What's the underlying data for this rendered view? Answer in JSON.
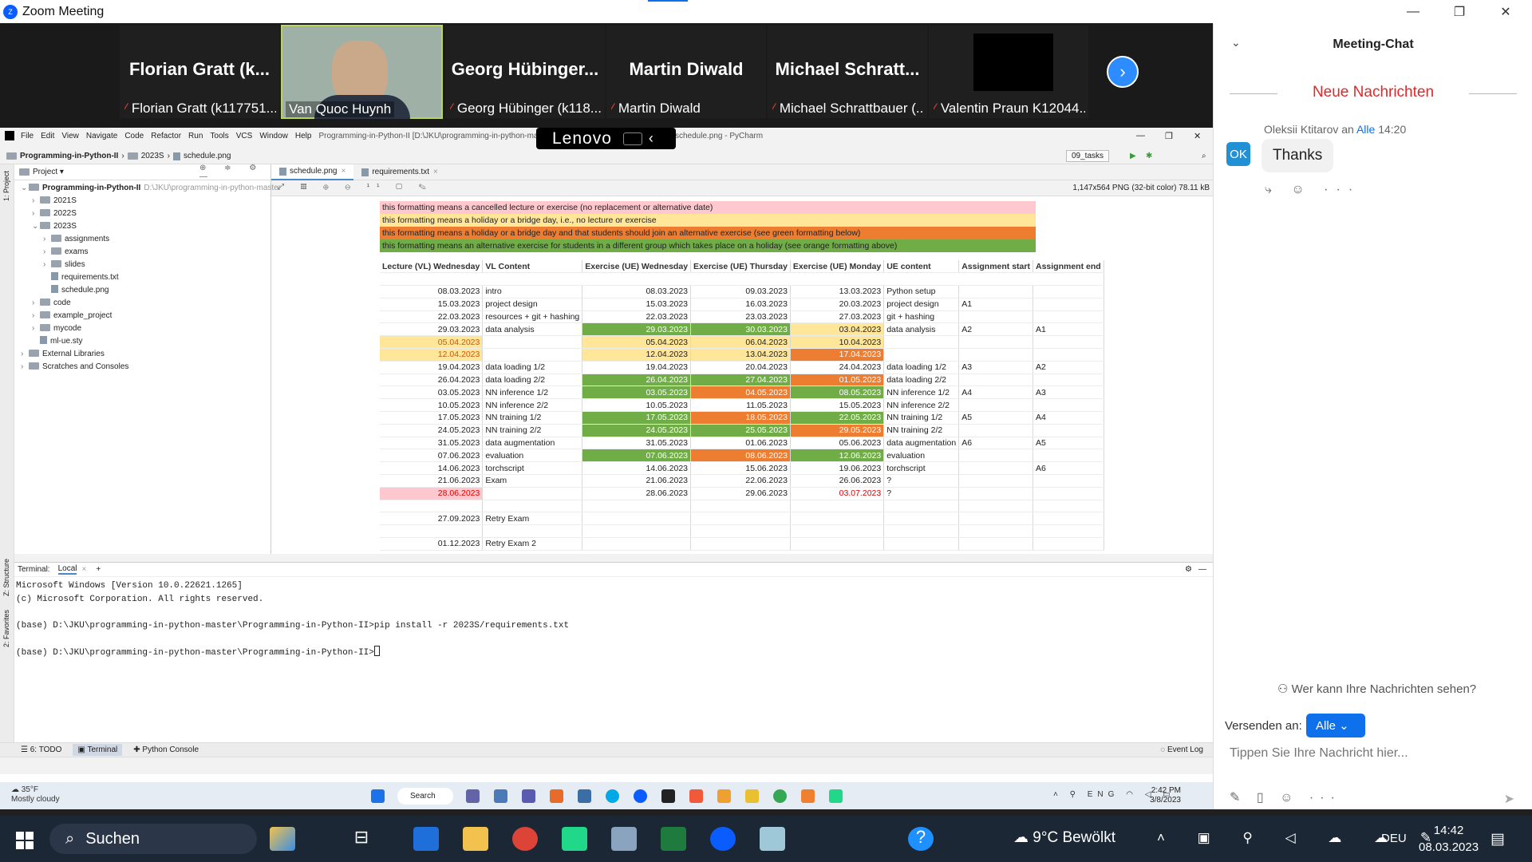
{
  "zoom": {
    "title": "Zoom Meeting",
    "logo": "Z",
    "min": "—",
    "restore": "❐",
    "close": "✕"
  },
  "participants": [
    {
      "big": "Florian Gratt (k...",
      "small": "Florian Gratt (k117751..."
    },
    {
      "big": "",
      "small": "Van Quoc Huynh"
    },
    {
      "big": "Georg Hübinger...",
      "small": "Georg Hübinger (k118..."
    },
    {
      "big": "Martin Diwald",
      "small": "Martin Diwald"
    },
    {
      "big": "Michael  Schratt...",
      "small": "Michael Schrattbauer (..."
    },
    {
      "big": "",
      "small": "Valentin Praun K12044..."
    }
  ],
  "next_icon": "›",
  "chat": {
    "header": "Meeting-Chat",
    "chev": "⌄",
    "new_messages": "Neue Nachrichten",
    "msg": {
      "sender": "Oleksii Ktitarov",
      "to_word": "an",
      "to": "Alle",
      "time": "14:20",
      "avatar": "OK",
      "text": "Thanks"
    },
    "actions": "⤷ ☺ ···",
    "who": "Wer kann Ihre Nachrichten sehen?",
    "send_label": "Versenden an:",
    "send_to": "Alle ⌄",
    "placeholder": "Tippen Sie Ihre Nachricht hier...",
    "tools": "✎ ▯ ☺ ···",
    "send_icon": "➤"
  },
  "pycharm": {
    "menu": [
      "File",
      "Edit",
      "View",
      "Navigate",
      "Code",
      "Refactor",
      "Run",
      "Tools",
      "VCS",
      "Window",
      "Help"
    ],
    "title": "Programming-in-Python-II [D:\\JKU\\programming-in-python-mast",
    "title2": "schedule.png - PyCharm",
    "lenovo": "Lenovo",
    "breadcrumb": [
      "Programming-in-Python-II",
      "2023S",
      "schedule.png"
    ],
    "run_config": "09_tasks",
    "project_label": "Project ▾",
    "tree": [
      {
        "label": "Programming-in-Python-II",
        "extra": "D:\\JKU\\programming-in-python-master",
        "depth": 0,
        "kind": "folder"
      },
      {
        "label": "2021S",
        "depth": 1,
        "kind": "folder"
      },
      {
        "label": "2022S",
        "depth": 1,
        "kind": "folder"
      },
      {
        "label": "2023S",
        "depth": 1,
        "kind": "folder"
      },
      {
        "label": "assignments",
        "depth": 2,
        "kind": "folder"
      },
      {
        "label": "exams",
        "depth": 2,
        "kind": "folder"
      },
      {
        "label": "slides",
        "depth": 2,
        "kind": "folder"
      },
      {
        "label": "requirements.txt",
        "depth": 2,
        "kind": "file"
      },
      {
        "label": "schedule.png",
        "depth": 2,
        "kind": "file"
      },
      {
        "label": "code",
        "depth": 1,
        "kind": "folder"
      },
      {
        "label": "example_project",
        "depth": 1,
        "kind": "folder"
      },
      {
        "label": "mycode",
        "depth": 1,
        "kind": "folder"
      },
      {
        "label": "ml-ue.sty",
        "depth": 1,
        "kind": "file"
      },
      {
        "label": "External Libraries",
        "depth": 0,
        "kind": "folder"
      },
      {
        "label": "Scratches and Consoles",
        "depth": 0,
        "kind": "folder"
      }
    ],
    "tabs": [
      "schedule.png",
      "requirements.txt"
    ],
    "image_info": "1,147x564 PNG (32-bit color) 78.11 kB",
    "legend": [
      "this formatting means a cancelled lecture or exercise (no replacement or alternative date)",
      "this formatting means a holiday or a bridge day, i.e., no lecture or exercise",
      "this formatting means a holiday or a bridge day and that students should join an alternative exercise (see green formatting below)",
      "this formatting means an alternative exercise for students in a different group which takes place on a holiday (see orange formatting above)"
    ],
    "headers": [
      "Lecture (VL) Wednesday",
      "VL Content",
      "Exercise (UE) Wednesday",
      "Exercise (UE) Thursday",
      "Exercise (UE) Monday",
      "UE content",
      "Assignment start",
      "Assignment end"
    ],
    "rows": [
      [
        "08.03.2023",
        "intro",
        "08.03.2023",
        "09.03.2023",
        "13.03.2023",
        "Python setup",
        "",
        ""
      ],
      [
        "15.03.2023",
        "project design",
        "15.03.2023",
        "16.03.2023",
        "20.03.2023",
        "project design",
        "A1",
        ""
      ],
      [
        "22.03.2023",
        "resources + git + hashing",
        "22.03.2023",
        "23.03.2023",
        "27.03.2023",
        "git + hashing",
        "",
        ""
      ],
      [
        "29.03.2023",
        "data analysis",
        "29.03.2023",
        "30.03.2023",
        "03.04.2023",
        "data analysis",
        "A2",
        "A1"
      ],
      [
        "05.04.2023",
        "",
        "05.04.2023",
        "06.04.2023",
        "10.04.2023",
        "",
        "",
        ""
      ],
      [
        "12.04.2023",
        "",
        "12.04.2023",
        "13.04.2023",
        "17.04.2023",
        "",
        "",
        ""
      ],
      [
        "19.04.2023",
        "data loading 1/2",
        "19.04.2023",
        "20.04.2023",
        "24.04.2023",
        "data loading 1/2",
        "A3",
        "A2"
      ],
      [
        "26.04.2023",
        "data loading 2/2",
        "26.04.2023",
        "27.04.2023",
        "01.05.2023",
        "data loading 2/2",
        "",
        ""
      ],
      [
        "03.05.2023",
        "NN inference 1/2",
        "03.05.2023",
        "04.05.2023",
        "08.05.2023",
        "NN inference 1/2",
        "A4",
        "A3"
      ],
      [
        "10.05.2023",
        "NN inference 2/2",
        "10.05.2023",
        "11.05.2023",
        "15.05.2023",
        "NN inference 2/2",
        "",
        ""
      ],
      [
        "17.05.2023",
        "NN training 1/2",
        "17.05.2023",
        "18.05.2023",
        "22.05.2023",
        "NN training 1/2",
        "A5",
        "A4"
      ],
      [
        "24.05.2023",
        "NN training 2/2",
        "24.05.2023",
        "25.05.2023",
        "29.05.2023",
        "NN training 2/2",
        "",
        ""
      ],
      [
        "31.05.2023",
        "data augmentation",
        "31.05.2023",
        "01.06.2023",
        "05.06.2023",
        "data augmentation",
        "A6",
        "A5"
      ],
      [
        "07.06.2023",
        "evaluation",
        "07.06.2023",
        "08.06.2023",
        "12.06.2023",
        "evaluation",
        "",
        ""
      ],
      [
        "14.06.2023",
        "torchscript",
        "14.06.2023",
        "15.06.2023",
        "19.06.2023",
        "torchscript",
        "",
        "A6"
      ],
      [
        "21.06.2023",
        "Exam",
        "21.06.2023",
        "22.06.2023",
        "26.06.2023",
        "?",
        "",
        ""
      ],
      [
        "28.06.2023",
        "",
        "28.06.2023",
        "29.06.2023",
        "03.07.2023",
        "?",
        "",
        ""
      ],
      [
        "",
        "",
        "",
        "",
        "",
        "",
        "",
        ""
      ],
      [
        "27.09.2023",
        "Retry Exam",
        "",
        "",
        "",
        "",
        "",
        ""
      ],
      [
        "",
        "",
        "",
        "",
        "",
        "",
        "",
        ""
      ],
      [
        "01.12.2023",
        "Retry Exam 2",
        "",
        "",
        "",
        "",
        "",
        ""
      ]
    ],
    "terminal_tabs": [
      "Terminal:",
      "Local"
    ],
    "terminal_text": "Microsoft Windows [Version 10.0.22621.1265]\n(c) Microsoft Corporation. All rights reserved.\n\n(base) D:\\JKU\\programming-in-python-master\\Programming-in-Python-II>pip install -r 2023S/requirements.txt\n\n(base) D:\\JKU\\programming-in-python-master\\Programming-in-Python-II>",
    "bottom_tabs": [
      "6: TODO",
      "Terminal",
      "Python Console"
    ],
    "event_log": "Event Log",
    "side_labels": [
      "1: Project",
      "Z: Structure",
      "2: Favorites"
    ]
  },
  "inner_taskbar": {
    "temp": "35°F",
    "weather": "Mostly cloudy",
    "search": "Search",
    "lang": "ENG",
    "time": "2:42 PM",
    "date": "3/8/2023"
  },
  "taskbar": {
    "search": "Suchen",
    "weather": "9°C  Bewölkt",
    "lang": "DEU",
    "time": "14:42",
    "date": "08.03.2023"
  }
}
